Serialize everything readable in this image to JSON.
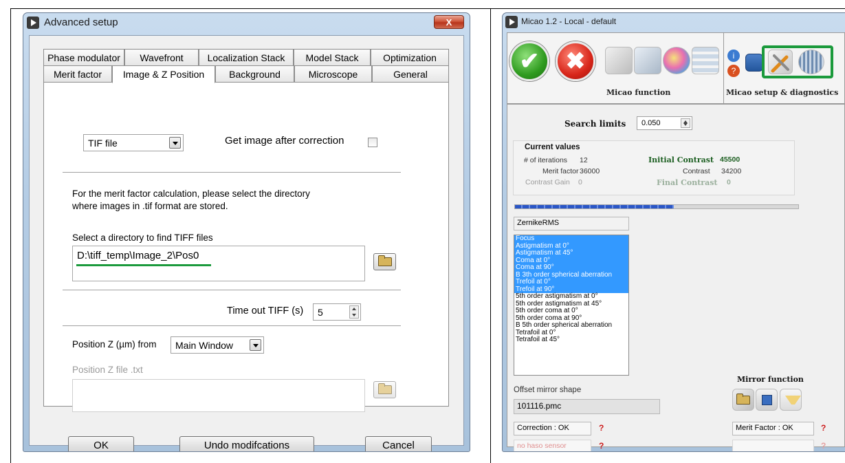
{
  "advanced": {
    "title": "Advanced setup",
    "close_glyph": "X",
    "tabs_row1": [
      "Phase modulator",
      "Wavefront",
      "Localization Stack",
      "Model Stack",
      "Optimization"
    ],
    "tabs_row2": [
      "Merit factor",
      "Image & Z Position",
      "Background",
      "Microscope",
      "General"
    ],
    "active_tab": "Image & Z Position",
    "image_source": "TIF file",
    "get_image_label": "Get image after correction",
    "info_line1": "For the merit factor calculation, please select the directory",
    "info_line2": " where images in .tif format are stored.",
    "select_dir_label": "Select a directory to find TIFF files",
    "directory_value": "D:\\tiff_temp\\Image_2\\Pos0",
    "timeout_label": "Time out TIFF (s)",
    "timeout_value": "5",
    "posz_label": "Position Z (µm) from",
    "posz_source": "Main Window",
    "posz_file_label": "Position Z file .txt",
    "posz_file_value": "",
    "ok": "OK",
    "undo": "Undo modifcations",
    "cancel": "Cancel",
    "highlight_color": "#1b9a3c"
  },
  "micao": {
    "title": "Micao 1.2 - Local - default",
    "function_label": "Micao function",
    "setup_label": "Micao setup & diagnostics",
    "highlight_color": "#1b9a3c",
    "search_limits_label": "Search limits",
    "search_limits_value": "0.050",
    "current_values_title": "Current values",
    "iterations_label": "# of iterations",
    "iterations_value": "12",
    "merit_label": "Merit factor",
    "merit_value": "36000",
    "gain_label": "Contrast Gain",
    "gain_value": "0",
    "initial_contrast_label": "Initial Contrast",
    "initial_contrast_value": "45500",
    "contrast_label": "Contrast",
    "contrast_value": "34200",
    "final_contrast_label": "Final Contrast",
    "final_contrast_value": "0",
    "progress_fraction": 0.56,
    "mode_value": "ZernikeRMS",
    "zernike_items": [
      {
        "label": "Focus",
        "selected": true
      },
      {
        "label": "Astigmatism at 0°",
        "selected": true
      },
      {
        "label": "Astigmatism at 45°",
        "selected": true
      },
      {
        "label": "Coma at 0°",
        "selected": true
      },
      {
        "label": "Coma at 90°",
        "selected": true
      },
      {
        "label": "B 3th order spherical aberration",
        "selected": true
      },
      {
        "label": "Trefoil at 0°",
        "selected": true
      },
      {
        "label": "Trefoil at 90°",
        "selected": true
      },
      {
        "label": "5th order astigmatism at 0°",
        "selected": false
      },
      {
        "label": "5th order astigmatism at 45°",
        "selected": false
      },
      {
        "label": "5th order coma at 0°",
        "selected": false
      },
      {
        "label": "5th order coma at 90°",
        "selected": false
      },
      {
        "label": "B 5th order spherical aberration",
        "selected": false
      },
      {
        "label": "Tetrafoil at 0°",
        "selected": false
      },
      {
        "label": "Tetrafoil at 45°",
        "selected": false
      }
    ],
    "mirror_function_label": "Mirror function",
    "offset_label": "Offset mirror shape",
    "offset_value": "101116.pmc",
    "correction_status": "Correction : OK",
    "merit_status": "Merit Factor : OK",
    "haso_status": "no haso sensor",
    "haso_right": "",
    "qmark": "?"
  }
}
